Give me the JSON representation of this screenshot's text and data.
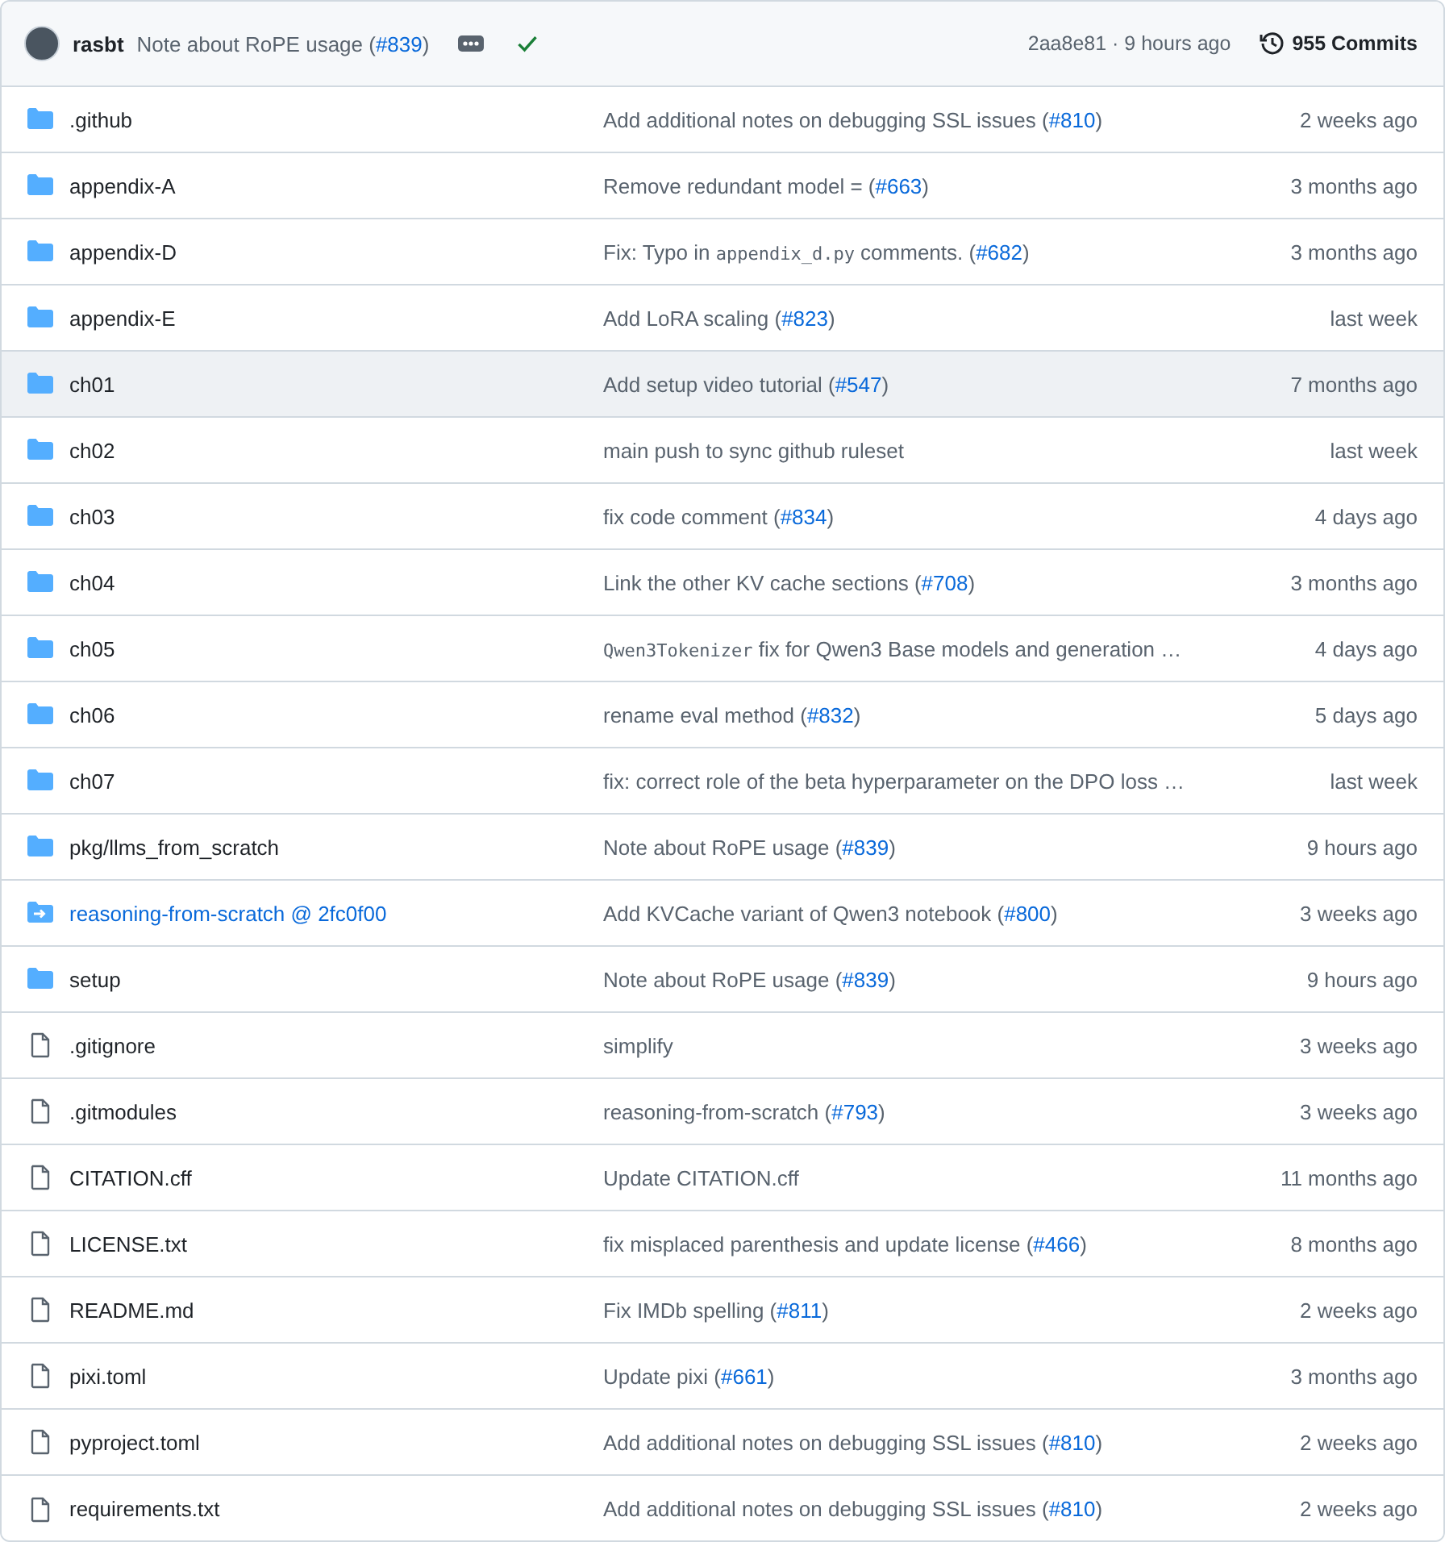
{
  "commit_bar": {
    "author": "rasbt",
    "message": [
      {
        "kind": "text",
        "text": "Note about RoPE usage ("
      },
      {
        "kind": "link",
        "text": "#839"
      },
      {
        "kind": "text",
        "text": ")"
      }
    ],
    "checks_passed": true,
    "sha": "2aa8e81 · 9 hours ago",
    "commits": "955 Commits"
  },
  "rows": [
    {
      "kind": "folder",
      "name": ".github",
      "selected": false,
      "message": [
        {
          "kind": "text",
          "text": "Add additional notes on debugging SSL issues ("
        },
        {
          "kind": "link",
          "text": "#810"
        },
        {
          "kind": "text",
          "text": ")"
        }
      ],
      "date": "2 weeks ago"
    },
    {
      "kind": "folder",
      "name": "appendix-A",
      "selected": false,
      "message": [
        {
          "kind": "text",
          "text": "Remove redundant model = ("
        },
        {
          "kind": "link",
          "text": "#663"
        },
        {
          "kind": "text",
          "text": ")"
        }
      ],
      "date": "3 months ago"
    },
    {
      "kind": "folder",
      "name": "appendix-D",
      "selected": false,
      "message": [
        {
          "kind": "text",
          "text": "Fix: Typo in "
        },
        {
          "kind": "code",
          "text": "appendix_d.py"
        },
        {
          "kind": "text",
          "text": " comments. ("
        },
        {
          "kind": "link",
          "text": "#682"
        },
        {
          "kind": "text",
          "text": ")"
        }
      ],
      "date": "3 months ago"
    },
    {
      "kind": "folder",
      "name": "appendix-E",
      "selected": false,
      "message": [
        {
          "kind": "text",
          "text": "Add LoRA scaling ("
        },
        {
          "kind": "link",
          "text": "#823"
        },
        {
          "kind": "text",
          "text": ")"
        }
      ],
      "date": "last week"
    },
    {
      "kind": "folder",
      "name": "ch01",
      "selected": true,
      "message": [
        {
          "kind": "text",
          "text": "Add setup video tutorial ("
        },
        {
          "kind": "link",
          "text": "#547"
        },
        {
          "kind": "text",
          "text": ")"
        }
      ],
      "date": "7 months ago"
    },
    {
      "kind": "folder",
      "name": "ch02",
      "selected": false,
      "message": [
        {
          "kind": "text",
          "text": "main push to sync github ruleset"
        }
      ],
      "date": "last week"
    },
    {
      "kind": "folder",
      "name": "ch03",
      "selected": false,
      "message": [
        {
          "kind": "text",
          "text": "fix code comment ("
        },
        {
          "kind": "link",
          "text": "#834"
        },
        {
          "kind": "text",
          "text": ")"
        }
      ],
      "date": "4 days ago"
    },
    {
      "kind": "folder",
      "name": "ch04",
      "selected": false,
      "message": [
        {
          "kind": "text",
          "text": "Link the other KV cache sections ("
        },
        {
          "kind": "link",
          "text": "#708"
        },
        {
          "kind": "text",
          "text": ")"
        }
      ],
      "date": "3 months ago"
    },
    {
      "kind": "folder",
      "name": "ch05",
      "selected": false,
      "message": [
        {
          "kind": "code",
          "text": "Qwen3Tokenizer"
        },
        {
          "kind": "text",
          "text": " fix for Qwen3 Base models and generation …"
        }
      ],
      "date": "4 days ago"
    },
    {
      "kind": "folder",
      "name": "ch06",
      "selected": false,
      "message": [
        {
          "kind": "text",
          "text": "rename eval method ("
        },
        {
          "kind": "link",
          "text": "#832"
        },
        {
          "kind": "text",
          "text": ")"
        }
      ],
      "date": "5 days ago"
    },
    {
      "kind": "folder",
      "name": "ch07",
      "selected": false,
      "message": [
        {
          "kind": "text",
          "text": "fix: correct role of the beta hyperparameter on the DPO loss …"
        }
      ],
      "date": "last week"
    },
    {
      "kind": "folder",
      "name": "pkg/llms_from_scratch",
      "selected": false,
      "message": [
        {
          "kind": "text",
          "text": "Note about RoPE usage ("
        },
        {
          "kind": "link",
          "text": "#839"
        },
        {
          "kind": "text",
          "text": ")"
        }
      ],
      "date": "9 hours ago"
    },
    {
      "kind": "submodule",
      "name": "reasoning-from-scratch @ 2fc0f00",
      "selected": false,
      "message": [
        {
          "kind": "text",
          "text": "Add KVCache variant of Qwen3 notebook ("
        },
        {
          "kind": "link",
          "text": "#800"
        },
        {
          "kind": "text",
          "text": ")"
        }
      ],
      "date": "3 weeks ago"
    },
    {
      "kind": "folder",
      "name": "setup",
      "selected": false,
      "message": [
        {
          "kind": "text",
          "text": "Note about RoPE usage ("
        },
        {
          "kind": "link",
          "text": "#839"
        },
        {
          "kind": "text",
          "text": ")"
        }
      ],
      "date": "9 hours ago"
    },
    {
      "kind": "file",
      "name": ".gitignore",
      "selected": false,
      "message": [
        {
          "kind": "text",
          "text": "simplify"
        }
      ],
      "date": "3 weeks ago"
    },
    {
      "kind": "file",
      "name": ".gitmodules",
      "selected": false,
      "message": [
        {
          "kind": "text",
          "text": "reasoning-from-scratch ("
        },
        {
          "kind": "link",
          "text": "#793"
        },
        {
          "kind": "text",
          "text": ")"
        }
      ],
      "date": "3 weeks ago"
    },
    {
      "kind": "file",
      "name": "CITATION.cff",
      "selected": false,
      "message": [
        {
          "kind": "text",
          "text": "Update CITATION.cff"
        }
      ],
      "date": "11 months ago"
    },
    {
      "kind": "file",
      "name": "LICENSE.txt",
      "selected": false,
      "message": [
        {
          "kind": "text",
          "text": "fix misplaced parenthesis and update license ("
        },
        {
          "kind": "link",
          "text": "#466"
        },
        {
          "kind": "text",
          "text": ")"
        }
      ],
      "date": "8 months ago"
    },
    {
      "kind": "file",
      "name": "README.md",
      "selected": false,
      "message": [
        {
          "kind": "text",
          "text": "Fix IMDb spelling ("
        },
        {
          "kind": "link",
          "text": "#811"
        },
        {
          "kind": "text",
          "text": ")"
        }
      ],
      "date": "2 weeks ago"
    },
    {
      "kind": "file",
      "name": "pixi.toml",
      "selected": false,
      "message": [
        {
          "kind": "text",
          "text": "Update pixi ("
        },
        {
          "kind": "link",
          "text": "#661"
        },
        {
          "kind": "text",
          "text": ")"
        }
      ],
      "date": "3 months ago"
    },
    {
      "kind": "file",
      "name": "pyproject.toml",
      "selected": false,
      "message": [
        {
          "kind": "text",
          "text": "Add additional notes on debugging SSL issues ("
        },
        {
          "kind": "link",
          "text": "#810"
        },
        {
          "kind": "text",
          "text": ")"
        }
      ],
      "date": "2 weeks ago"
    },
    {
      "kind": "file",
      "name": "requirements.txt",
      "selected": false,
      "message": [
        {
          "kind": "text",
          "text": "Add additional notes on debugging SSL issues ("
        },
        {
          "kind": "link",
          "text": "#810"
        },
        {
          "kind": "text",
          "text": ")"
        }
      ],
      "date": "2 weeks ago"
    }
  ]
}
